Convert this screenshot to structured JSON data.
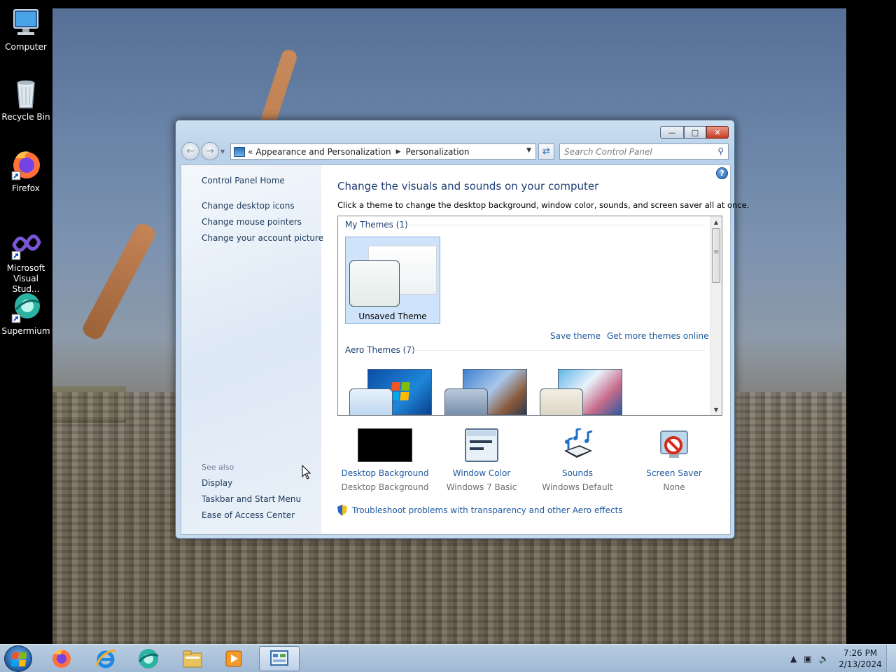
{
  "desktop": {
    "icons": [
      {
        "label": "Computer",
        "icon": "computer-icon"
      },
      {
        "label": "Recycle Bin",
        "icon": "recycle-bin-icon"
      },
      {
        "label": "Firefox",
        "icon": "firefox-icon"
      },
      {
        "label": "Microsoft Visual Stud...",
        "icon": "visual-studio-icon"
      },
      {
        "label": "Supermium",
        "icon": "supermium-icon"
      }
    ]
  },
  "window": {
    "title_buttons": {
      "minimize": "—",
      "maximize": "□",
      "close": "✕"
    },
    "address": {
      "prefix": "«",
      "crumbs": [
        "Appearance and Personalization",
        "Personalization"
      ]
    },
    "search": {
      "placeholder": "Search Control Panel"
    },
    "help": "?"
  },
  "left_pane": {
    "home": "Control Panel Home",
    "links": [
      "Change desktop icons",
      "Change mouse pointers",
      "Change your account picture"
    ],
    "see_also_label": "See also",
    "see_also": [
      "Display",
      "Taskbar and Start Menu",
      "Ease of Access Center"
    ]
  },
  "main": {
    "title": "Change the visuals and sounds on your computer",
    "description": "Click a theme to change the desktop background, window color, sounds, and screen saver all at once.",
    "my_themes_label": "My Themes (1)",
    "unsaved_theme": "Unsaved Theme",
    "save_theme": "Save theme",
    "get_more_themes": "Get more themes online",
    "aero_themes_label": "Aero Themes (7)",
    "options": [
      {
        "label": "Desktop Background",
        "value": "Desktop Background",
        "icon": "desktop-background-icon"
      },
      {
        "label": "Window Color",
        "value": "Windows 7 Basic",
        "icon": "window-color-icon"
      },
      {
        "label": "Sounds",
        "value": "Windows Default",
        "icon": "sounds-icon"
      },
      {
        "label": "Screen Saver",
        "value": "None",
        "icon": "screen-saver-icon"
      }
    ],
    "troubleshoot": "Troubleshoot problems with transparency and other Aero effects"
  },
  "taskbar": {
    "items": [
      "firefox-icon",
      "internet-explorer-icon",
      "supermium-icon",
      "file-explorer-icon",
      "media-player-icon",
      "control-panel-icon"
    ],
    "clock": {
      "time": "7:26 PM",
      "date": "2/13/2024"
    }
  },
  "colors": {
    "link": "#1f5aa0",
    "title": "#1e3f75",
    "selected_tile": "#cfe3fb"
  }
}
